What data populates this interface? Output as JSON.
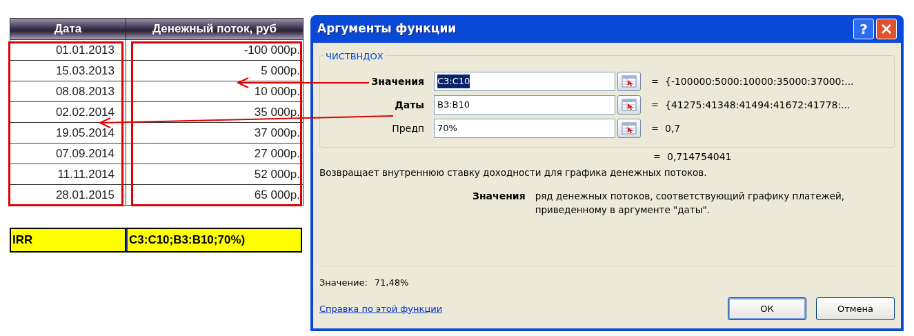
{
  "sheet": {
    "columns": [
      "Дата",
      "Денежный поток, руб"
    ],
    "rows": [
      {
        "date": "01.01.2013",
        "amount": "-100 000р."
      },
      {
        "date": "15.03.2013",
        "amount": "5 000р."
      },
      {
        "date": "08.08.2013",
        "amount": "10 000р."
      },
      {
        "date": "02.02.2014",
        "amount": "35 000р."
      },
      {
        "date": "19.05.2014",
        "amount": "37 000р."
      },
      {
        "date": "07.09.2014",
        "amount": "27 000р."
      },
      {
        "date": "11.11.2014",
        "amount": "52 000р."
      },
      {
        "date": "28.01.2015",
        "amount": "65 000р."
      }
    ],
    "irr_row": {
      "label": "IRR",
      "formula": "C3:C10;B3:B10;70%)"
    }
  },
  "dialog": {
    "title": "Аргументы функции",
    "help_button": "?",
    "group_title": "ЧИСТВНДОХ",
    "arguments": [
      {
        "label": "Значения",
        "required": true,
        "value": "C3:C10",
        "value_selected": true,
        "equals": "=",
        "result": "{-100000:5000:10000:35000:37000:..."
      },
      {
        "label": "Даты",
        "required": true,
        "value": "B3:B10",
        "value_selected": false,
        "equals": "=",
        "result": "{41275:41348:41494:41672:41778:..."
      },
      {
        "label": "Предп",
        "required": false,
        "value": "70%",
        "value_selected": false,
        "equals": "=",
        "result": "0,7"
      }
    ],
    "formula_result_equals": "=",
    "formula_result": "0,714754041",
    "description": "Возвращает внутреннюю ставку доходности для графика денежных потоков.",
    "argument_help": {
      "name": "Значения",
      "text": "ряд денежных потоков, соответствующий графику платежей, приведенному в аргументе \"даты\"."
    },
    "result_label": "Значение:",
    "result_value": "71,48%",
    "help_link": "Справка по этой функции",
    "buttons": [
      {
        "label": "ОК",
        "default": true
      },
      {
        "label": "Отмена",
        "default": false
      }
    ]
  }
}
